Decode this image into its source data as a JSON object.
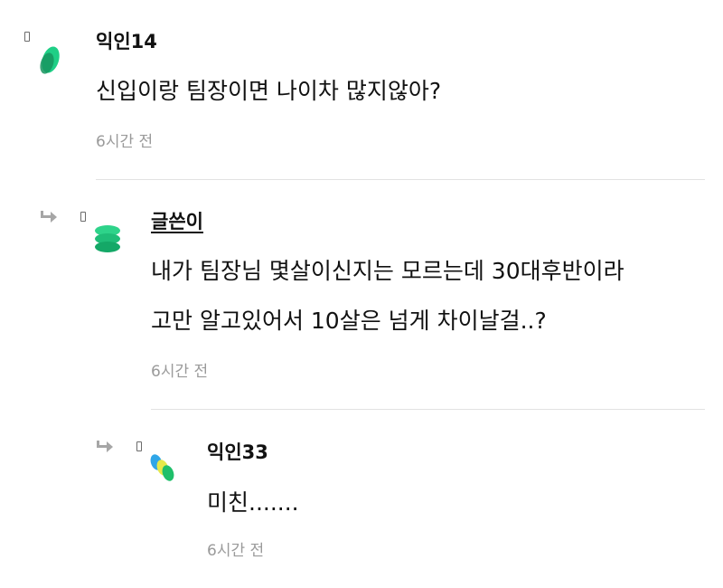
{
  "comments": [
    {
      "author": "익인14",
      "body_lines": [
        "신입이랑 팀장이면 나이차 많지않아?"
      ],
      "time": "6시간 전",
      "is_reply": false,
      "is_original_poster": false,
      "avatar_icon": "green-mint-leaf-avatar",
      "avatar_colors": [
        "#1fcf86",
        "#17955f"
      ]
    },
    {
      "author": "글쓴이",
      "body_lines": [
        "내가 팀장님 몇살이신지는 모르는데 30대후반이라",
        "고만 알고있어서 10살은 넘게 차이날걸..?"
      ],
      "time": "6시간 전",
      "is_reply": true,
      "is_original_poster": true,
      "avatar_icon": "green-stacked-discs-avatar",
      "avatar_colors": [
        "#2ed38a",
        "#14a867"
      ]
    },
    {
      "author": "익인33",
      "body_lines": [
        "미친......."
      ],
      "time": "6시간 전",
      "is_reply": true,
      "is_original_poster": false,
      "avatar_icon": "blue-yellow-green-pills-avatar",
      "avatar_colors": [
        "#2fa6e8",
        "#e6e84a",
        "#1fbf6a"
      ]
    }
  ],
  "colors": {
    "text": "#111111",
    "meta": "#9a9a9a",
    "divider": "#e2e2e2",
    "reply_arrow": "#a6a6a6"
  }
}
